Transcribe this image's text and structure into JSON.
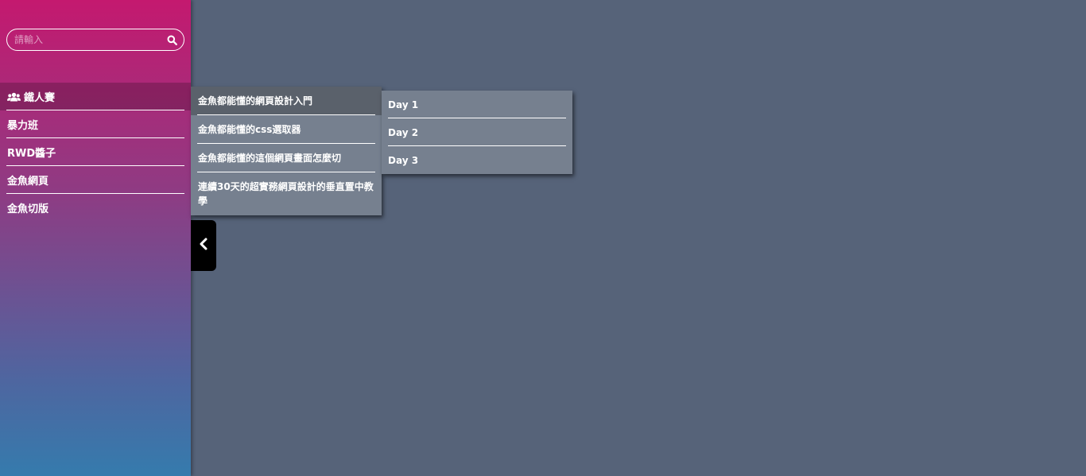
{
  "search": {
    "placeholder": "請輸入",
    "icon": "search-icon"
  },
  "menu": {
    "items": [
      {
        "label": "鐵人賽",
        "icon": "users-icon",
        "active": true
      },
      {
        "label": "暴力班"
      },
      {
        "label": "RWD醬子"
      },
      {
        "label": "金魚網頁"
      },
      {
        "label": "金魚切版"
      }
    ]
  },
  "submenu": {
    "items": [
      {
        "label": "金魚都能懂的網頁設計入門",
        "active": true
      },
      {
        "label": "金魚都能懂的css選取器"
      },
      {
        "label": "金魚都能懂的這個網頁畫面怎麼切"
      },
      {
        "label": "連續30天的超實務網頁設計的垂直置中教學"
      }
    ]
  },
  "submenu2": {
    "items": [
      {
        "label": "Day 1"
      },
      {
        "label": "Day 2"
      },
      {
        "label": "Day 3"
      }
    ]
  },
  "toggle": {
    "icon": "chevron-left-icon"
  },
  "colors": {
    "background": "#566379",
    "sidebar_top": "#c4196f",
    "sidebar_bottom": "#357bad",
    "submenu_bg": "#76808f",
    "submenu_active_bg": "#5a616b",
    "toggle_bg": "#000000"
  }
}
